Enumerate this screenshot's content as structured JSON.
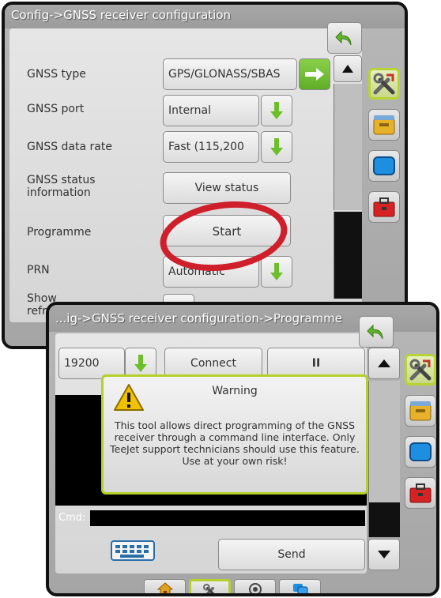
{
  "screen1": {
    "title": "Config->GNSS receiver configuration",
    "rows": [
      {
        "label": "GNSS type",
        "value": "GPS/GLONASS/SBAS"
      },
      {
        "label": "GNSS port",
        "value": "Internal"
      },
      {
        "label": "GNSS data rate",
        "value": "Fast (115,200"
      },
      {
        "label": "GNSS status information",
        "value": "View status"
      },
      {
        "label": "Programme",
        "value": "Start"
      },
      {
        "label": "PRN",
        "value": "Automatic"
      },
      {
        "label": "Show refresh GNSS",
        "value": ""
      }
    ],
    "highlight_color": "#cf1f2a"
  },
  "screen2": {
    "title": "...ig->GNSS receiver configuration->Programme",
    "baud": "19200",
    "connect_label": "Connect",
    "pause_label": "II",
    "warning": {
      "title": "Warning",
      "text": "This tool allows direct programming of the GNSS receiver through a command line interface. Only TeeJet support technicians should use this feature. Use at your own risk!"
    },
    "cmd_label": "Cmd:",
    "send_label": "Send"
  },
  "colors": {
    "accent_green": "#6cbf2a",
    "active_border": "#b6cf2a"
  },
  "icons": {
    "back": "back-arrow-icon",
    "tools": "tools-icon",
    "console": "console-icon",
    "display": "display-icon",
    "toolbox": "toolbox-icon",
    "keyboard": "keyboard-icon",
    "home": "home-icon",
    "gps": "gps-icon",
    "layers": "layers-icon"
  }
}
